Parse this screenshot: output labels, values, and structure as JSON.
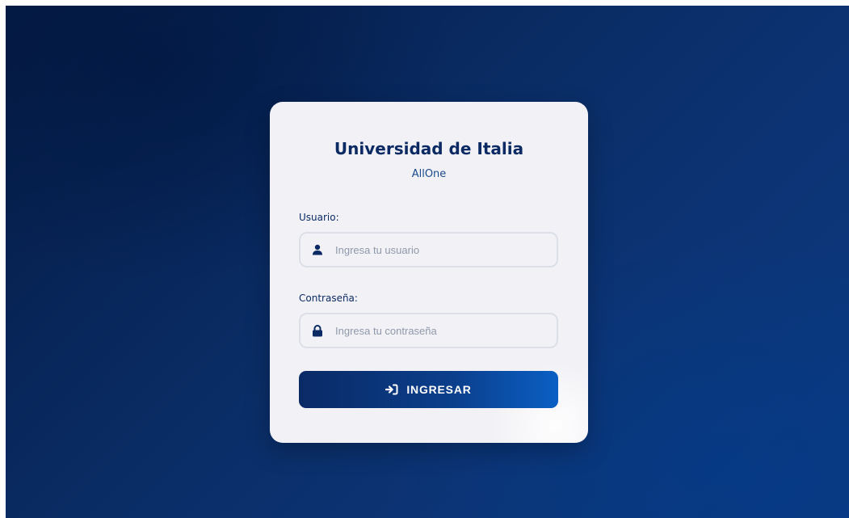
{
  "login": {
    "title": "Universidad de Italia",
    "subtitle": "AllOne",
    "username": {
      "label": "Usuario:",
      "placeholder": "Ingresa tu usuario",
      "value": "",
      "icon": "user-icon"
    },
    "password": {
      "label": "Contraseña:",
      "placeholder": "Ingresa tu contraseña",
      "value": "",
      "icon": "lock-icon"
    },
    "submit": {
      "label": "INGRESAR",
      "icon": "sign-in-icon"
    }
  },
  "colors": {
    "background_dark": "#041b45",
    "background_light": "#0b3a82",
    "card": "#f2f2f6",
    "title": "#0b2a63",
    "button_start": "#0a2a66",
    "button_end": "#0a5fc4"
  }
}
